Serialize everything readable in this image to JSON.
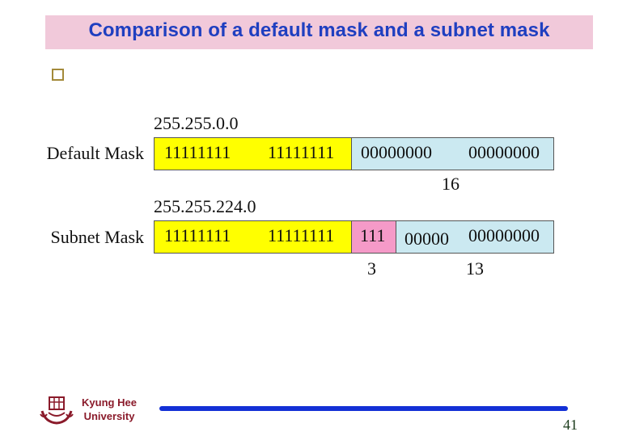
{
  "slide": {
    "title": "Comparison of a default mask and a subnet mask",
    "bullet_icon": "hollow-square-bullet-icon",
    "colors": {
      "title_bg": "#f1c9da",
      "title_text": "#1f3fc0",
      "network_bits": "#ffff00",
      "subnet_bits": "#f59ac8",
      "host_bits": "#cbe9f1",
      "footer_bar": "#1330d6"
    }
  },
  "diagram": {
    "default_mask": {
      "label": "Default Mask",
      "dotted_decimal": "255.255.0.0",
      "octets": [
        "11111111",
        "11111111",
        "00000000",
        "00000000"
      ],
      "host_bits_count": "16"
    },
    "subnet_mask": {
      "label": "Subnet Mask",
      "dotted_decimal": "255.255.224.0",
      "octets": [
        "11111111",
        "11111111",
        "111",
        "00000",
        "00000000"
      ],
      "subnet_bits_count": "3",
      "host_bits_count": "13"
    }
  },
  "footer": {
    "university_line1": "Kyung Hee",
    "university_line2": "University",
    "logo_icon": "university-emblem-icon",
    "page_number": "41"
  }
}
